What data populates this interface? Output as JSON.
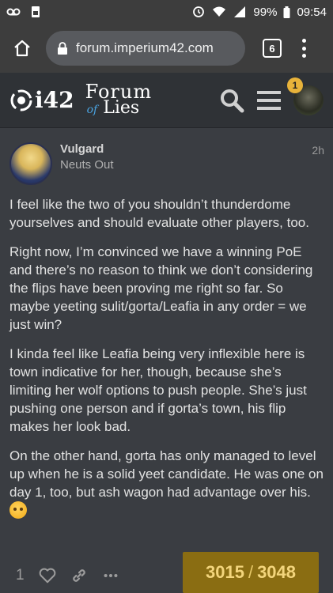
{
  "status_bar": {
    "battery": "99%",
    "time": "09:54"
  },
  "browser": {
    "url": "forum.imperium42.com",
    "tab_count": "6"
  },
  "forum": {
    "logo_i42": "i42",
    "logo_forum": "Forum",
    "logo_of": "of",
    "logo_lies": "Lies",
    "notification_count": "1"
  },
  "post": {
    "author": "Vulgard",
    "author_title": "Neuts Out",
    "time": "2h",
    "paragraphs": [
      "I feel like the two of you shouldn’t thunderdome yourselves and should evaluate other players, too.",
      "Right now, I’m convinced we have a winning PoE and there’s no reason to think we don’t considering the flips have been proving me right so far. So maybe yeeting sulit/gorta/Leafia in any order = we just win?",
      "I kinda feel like Leafia being very inflexible here is town indicative for her, though, because she’s limiting her wolf options to push people. She’s just pushing one person and if gorta’s town, his flip makes her look bad.",
      "On the other hand, gorta has only managed to level up when he is a solid yeet candidate. He was one on day 1, too, but ash wagon had advantage over his."
    ],
    "like_count": "1"
  },
  "progress": {
    "current": "3015",
    "separator": "/",
    "total": "3048"
  },
  "colors": {
    "progress_bg": "#8a6d12",
    "progress_text": "#f3d57c",
    "badge": "#e8b33a"
  }
}
